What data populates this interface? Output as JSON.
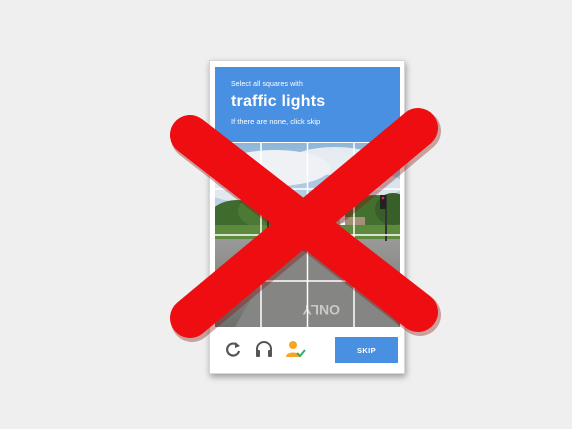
{
  "captcha": {
    "instruction": "Select all squares with",
    "target": "traffic lights",
    "hint": "If there are none, click skip",
    "skip_label": "SKIP",
    "road_marking": "ONLY",
    "grid": {
      "rows": 4,
      "cols": 4
    }
  },
  "icons": {
    "reload": "reload-icon",
    "audio": "headphones-icon",
    "info": "user-check-icon"
  },
  "colors": {
    "accent": "#4a90e2",
    "cross": "#ee0d10",
    "check": "#2eaf6a",
    "user": "#f5a623"
  }
}
